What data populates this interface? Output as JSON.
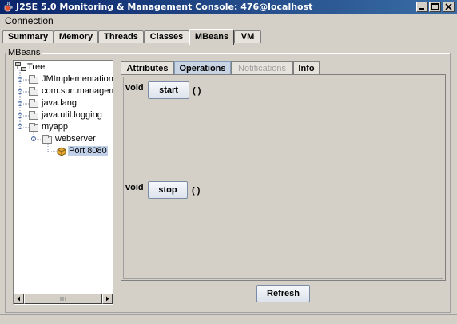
{
  "window": {
    "title": "J2SE 5.0 Monitoring & Management Console: 476@localhost",
    "icon": "java-cup-icon",
    "controls": [
      "minimize",
      "maximize",
      "close"
    ]
  },
  "menubar": {
    "connection": "Connection"
  },
  "main_tabs": {
    "summary": "Summary",
    "memory": "Memory",
    "threads": "Threads",
    "classes": "Classes",
    "mbeans": "MBeans",
    "vm": "VM",
    "selected": "MBeans"
  },
  "mbeans_panel": {
    "label": "MBeans"
  },
  "tree": {
    "root": "Tree",
    "nodes": {
      "jmimpl": "JMImplementation",
      "comsun": "com.sun.managem",
      "javalang": "java.lang",
      "javautil": "java.util.logging",
      "myapp": "myapp",
      "webserver": "webserver",
      "port": "Port 8080"
    },
    "selected": "Port 8080"
  },
  "detail_tabs": {
    "attributes": "Attributes",
    "operations": "Operations",
    "notifications": "Notifications",
    "info": "Info",
    "selected": "Operations",
    "disabled": "Notifications"
  },
  "operations": {
    "start": {
      "return_type": "void",
      "name": "start",
      "params": "( )"
    },
    "stop": {
      "return_type": "void",
      "name": "stop",
      "params": "( )"
    }
  },
  "refresh_label": "Refresh",
  "colors": {
    "title_start": "#0a246a",
    "title_end": "#3a6ea5",
    "face": "#d4d0c8",
    "selection": "#c0d0e8"
  }
}
